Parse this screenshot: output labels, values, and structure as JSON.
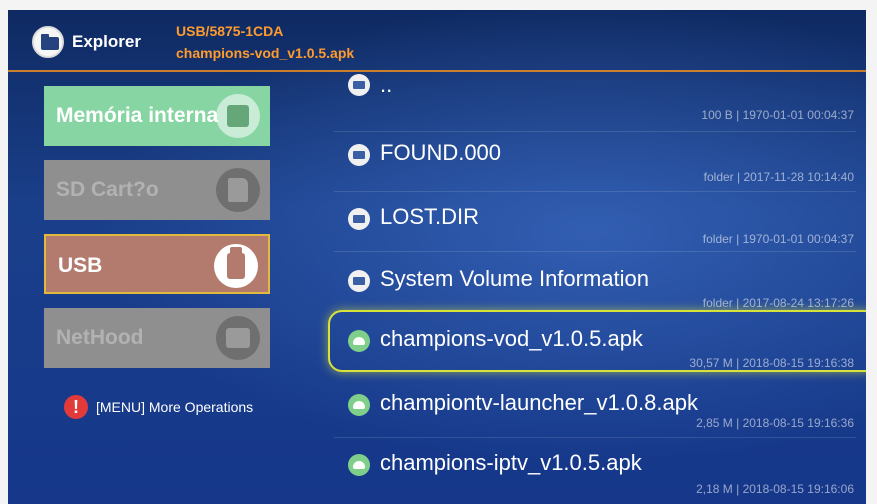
{
  "header": {
    "app_title": "Explorer",
    "path_device": "USB/5875-1CDA",
    "path_file": "champions-vod_v1.0.5.apk"
  },
  "sidebar": {
    "devices": [
      {
        "label": "Memória interna",
        "icon": "internal-memory-icon",
        "state": "available"
      },
      {
        "label": "SD Cart?o",
        "icon": "sd-card-icon",
        "state": "disabled"
      },
      {
        "label": "USB",
        "icon": "usb-icon",
        "state": "selected"
      },
      {
        "label": "NetHood",
        "icon": "network-icon",
        "state": "disabled"
      }
    ],
    "menu_hint": "[MENU] More Operations"
  },
  "files": [
    {
      "name": "..",
      "meta": "100 B | 1970-01-01 00:04:37",
      "type": "folder"
    },
    {
      "name": "FOUND.000",
      "meta": "folder | 2017-11-28 10:14:40",
      "type": "folder"
    },
    {
      "name": "LOST.DIR",
      "meta": "folder | 1970-01-01 00:04:37",
      "type": "folder"
    },
    {
      "name": "System Volume Information",
      "meta": "folder | 2017-08-24 13:17:26",
      "type": "folder"
    },
    {
      "name": "champions-vod_v1.0.5.apk",
      "meta": "30,57 M | 2018-08-15 19:16:38",
      "type": "apk",
      "selected": true
    },
    {
      "name": "championtv-launcher_v1.0.8.apk",
      "meta": "2,85 M | 2018-08-15 19:16:36",
      "type": "apk"
    },
    {
      "name": "champions-iptv_v1.0.5.apk",
      "meta": "2,18 M | 2018-08-15 19:16:06",
      "type": "apk"
    }
  ],
  "colors": {
    "accent_orange": "#ff9b2d",
    "selection_highlight": "#d8e33a",
    "background_blue": "#1a3f8a"
  }
}
